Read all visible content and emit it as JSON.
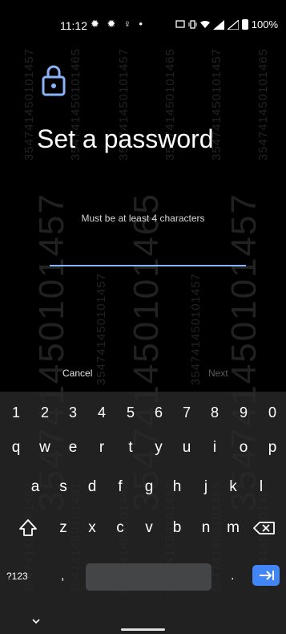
{
  "status_bar": {
    "time": "11:12",
    "icons_left": "✹ ✹ ♀ •",
    "battery_percent": "100%"
  },
  "watermark": {
    "imei": "354741450101457",
    "imei_short": "354741450101465"
  },
  "title": "Set a password",
  "hint": "Must be at least 4 characters",
  "actions": {
    "cancel_label": "Cancel",
    "next_label": "Next"
  },
  "keyboard": {
    "numbers": [
      "1",
      "2",
      "3",
      "4",
      "5",
      "6",
      "7",
      "8",
      "9",
      "0"
    ],
    "row1": [
      "q",
      "w",
      "e",
      "r",
      "t",
      "y",
      "u",
      "i",
      "o",
      "p"
    ],
    "row2": [
      "a",
      "s",
      "d",
      "f",
      "g",
      "h",
      "j",
      "k",
      "l"
    ],
    "row3": [
      "z",
      "x",
      "c",
      "v",
      "b",
      "n",
      "m"
    ],
    "symbols_label": "?123",
    "comma": ",",
    "period": "."
  },
  "colors": {
    "accent": "#8ab4f8",
    "enter_key": "#4285f4",
    "keyboard_bg": "#2a2a2c"
  }
}
